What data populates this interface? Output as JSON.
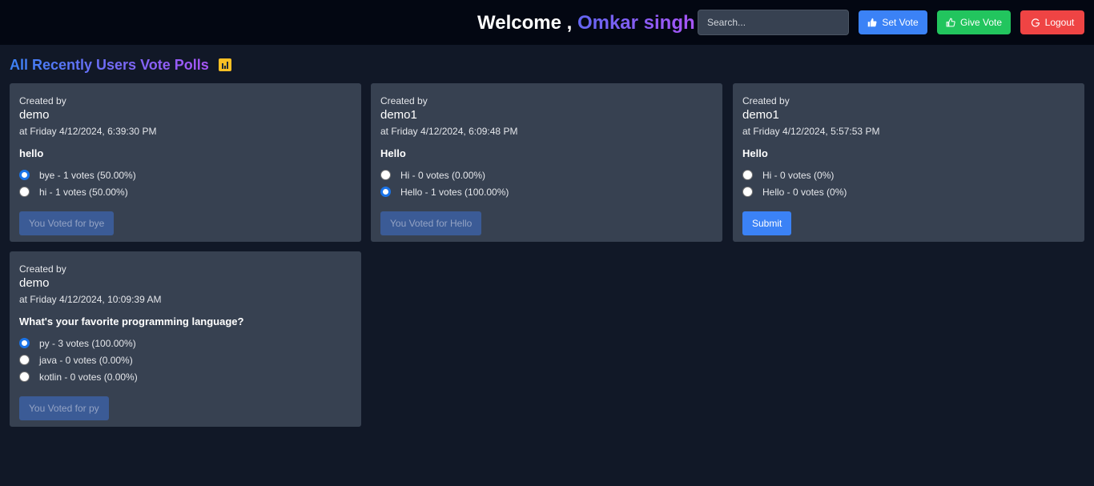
{
  "header": {
    "welcome_prefix": "Welcome ,",
    "user_name": "Omkar singh",
    "search_placeholder": "Search...",
    "set_vote_label": "Set Vote",
    "give_vote_label": "Give Vote",
    "logout_label": "Logout"
  },
  "page": {
    "heading": "All Recently Users Vote Polls",
    "heading_icon": "bar-chart-icon"
  },
  "polls": [
    {
      "created_by_label": "Created by",
      "creator": "demo",
      "date": "at Friday 4/12/2024, 6:39:30 PM",
      "question": "hello",
      "options": [
        {
          "text": "bye - 1 votes (50.00%)",
          "checked": true
        },
        {
          "text": "hi - 1 votes (50.00%)",
          "checked": false
        }
      ],
      "action_label": "You Voted for bye",
      "action_type": "voted"
    },
    {
      "created_by_label": "Created by",
      "creator": "demo1",
      "date": "at Friday 4/12/2024, 6:09:48 PM",
      "question": "Hello",
      "options": [
        {
          "text": "Hi - 0 votes (0.00%)",
          "checked": false
        },
        {
          "text": "Hello - 1 votes (100.00%)",
          "checked": true
        }
      ],
      "action_label": "You Voted for Hello",
      "action_type": "voted"
    },
    {
      "created_by_label": "Created by",
      "creator": "demo1",
      "date": "at Friday 4/12/2024, 5:57:53 PM",
      "question": "Hello",
      "options": [
        {
          "text": "Hi - 0 votes (0%)",
          "checked": false
        },
        {
          "text": "Hello - 0 votes (0%)",
          "checked": false
        }
      ],
      "action_label": "Submit",
      "action_type": "submit"
    },
    {
      "created_by_label": "Created by",
      "creator": "demo",
      "date": "at Friday 4/12/2024, 10:09:39 AM",
      "question": "What's your favorite programming language?",
      "options": [
        {
          "text": "py - 3 votes (100.00%)",
          "checked": true
        },
        {
          "text": "java - 0 votes (0.00%)",
          "checked": false
        },
        {
          "text": "kotlin - 0 votes (0.00%)",
          "checked": false
        }
      ],
      "action_label": "You Voted for py",
      "action_type": "voted"
    }
  ],
  "colors": {
    "background": "#111827",
    "topbar": "#030712",
    "card": "#374151",
    "primary": "#3b82f6",
    "success": "#22c55e",
    "danger": "#ef4444"
  }
}
